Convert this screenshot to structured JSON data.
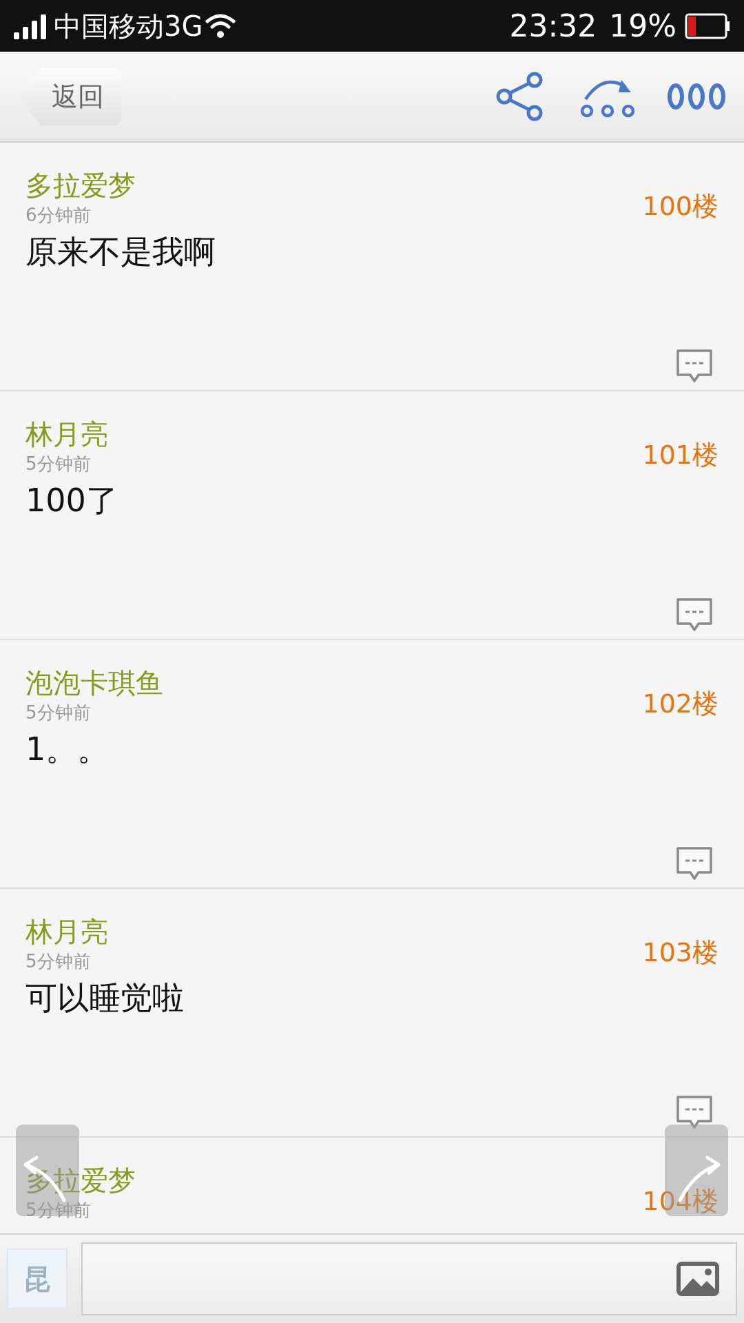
{
  "status_bar": {
    "carrier": "中国移动3G",
    "time": "23:32",
    "battery": "19%"
  },
  "top_bar": {
    "back": "返回"
  },
  "posts": [
    {
      "author": "多拉爱梦",
      "time": "6分钟前",
      "content": "原来不是我啊",
      "floor": "100楼"
    },
    {
      "author": "林月亮",
      "time": "5分钟前",
      "content": "100了",
      "floor": "101楼"
    },
    {
      "author": "泡泡卡琪鱼",
      "time": "5分钟前",
      "content": "1。。",
      "floor": "102楼"
    },
    {
      "author": "林月亮",
      "time": "5分钟前",
      "content": "可以睡觉啦",
      "floor": "103楼"
    },
    {
      "author": "多拉爱梦",
      "time": "5分钟前",
      "floor": "104楼"
    }
  ],
  "input_bar": {
    "emoji_key": "昆"
  }
}
